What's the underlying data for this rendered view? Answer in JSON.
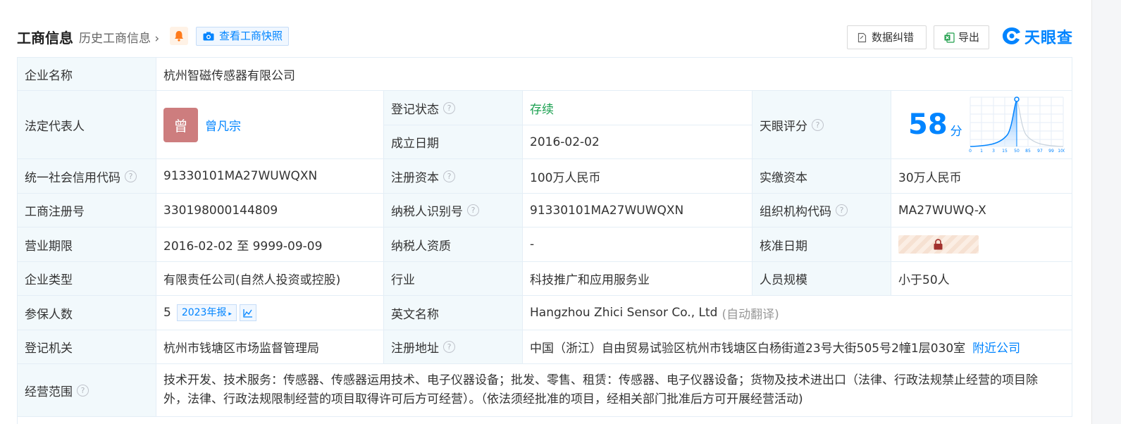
{
  "header": {
    "title": "工商信息",
    "history": "历史工商信息",
    "snapshot_label": "查看工商快照",
    "fix_label": "数据纠错",
    "export_label": "导出",
    "logo_text": "天眼查"
  },
  "rows": {
    "company_name": {
      "label": "企业名称",
      "value": "杭州智磁传感器有限公司"
    },
    "legal_rep": {
      "label": "法定代表人",
      "avatar_char": "曾",
      "name": "曾凡宗"
    },
    "reg_status": {
      "label": "登记状态",
      "value": "存续"
    },
    "found_date": {
      "label": "成立日期",
      "value": "2016-02-02"
    },
    "score": {
      "label": "天眼评分",
      "value": "58",
      "unit": "分",
      "axis_ticks": [
        "0",
        "1",
        "3",
        "15",
        "50",
        "85",
        "97",
        "99",
        "100"
      ]
    },
    "credit_code": {
      "label": "统一社会信用代码",
      "value": "91330101MA27WUWQXN"
    },
    "reg_capital": {
      "label": "注册资本",
      "value": "100万人民币"
    },
    "paid_capital": {
      "label": "实缴资本",
      "value": "30万人民币"
    },
    "biz_reg_no": {
      "label": "工商注册号",
      "value": "330198000144809"
    },
    "taxpayer_id": {
      "label": "纳税人识别号",
      "value": "91330101MA27WUWQXN"
    },
    "org_code": {
      "label": "组织机构代码",
      "value": "MA27WUWQ-X"
    },
    "biz_term": {
      "label": "营业期限",
      "value": "2016-02-02 至 9999-09-09"
    },
    "taxpayer_qual": {
      "label": "纳税人资质",
      "value": "-"
    },
    "approve_date": {
      "label": "核准日期"
    },
    "company_type": {
      "label": "企业类型",
      "value": "有限责任公司(自然人投资或控股)"
    },
    "industry": {
      "label": "行业",
      "value": "科技推广和应用服务业"
    },
    "staff_size": {
      "label": "人员规模",
      "value": "小于50人"
    },
    "insured": {
      "label": "参保人数",
      "value": "5",
      "report_tag": "2023年报"
    },
    "english_name": {
      "label": "英文名称",
      "value": "Hangzhou Zhici Sensor Co., Ltd",
      "note": "(自动翻译)"
    },
    "reg_authority": {
      "label": "登记机关",
      "value": "杭州市钱塘区市场监督管理局"
    },
    "reg_address": {
      "label": "注册地址",
      "value": "中国（浙江）自由贸易试验区杭州市钱塘区白杨街道23号大街505号2幢1层030室",
      "nearby_link": "附近公司"
    },
    "scope": {
      "label": "经营范围",
      "value": "技术开发、技术服务：传感器、传感器运用技术、电子仪器设备；批发、零售、租赁：传感器、电子仪器设备；货物及技术进出口（法律、行政法规禁止经营的项目除外，法律、行政法规限制经营的项目取得许可后方可经营）。（依法须经批准的项目，经相关部门批准后方可开展经营活动)"
    }
  }
}
